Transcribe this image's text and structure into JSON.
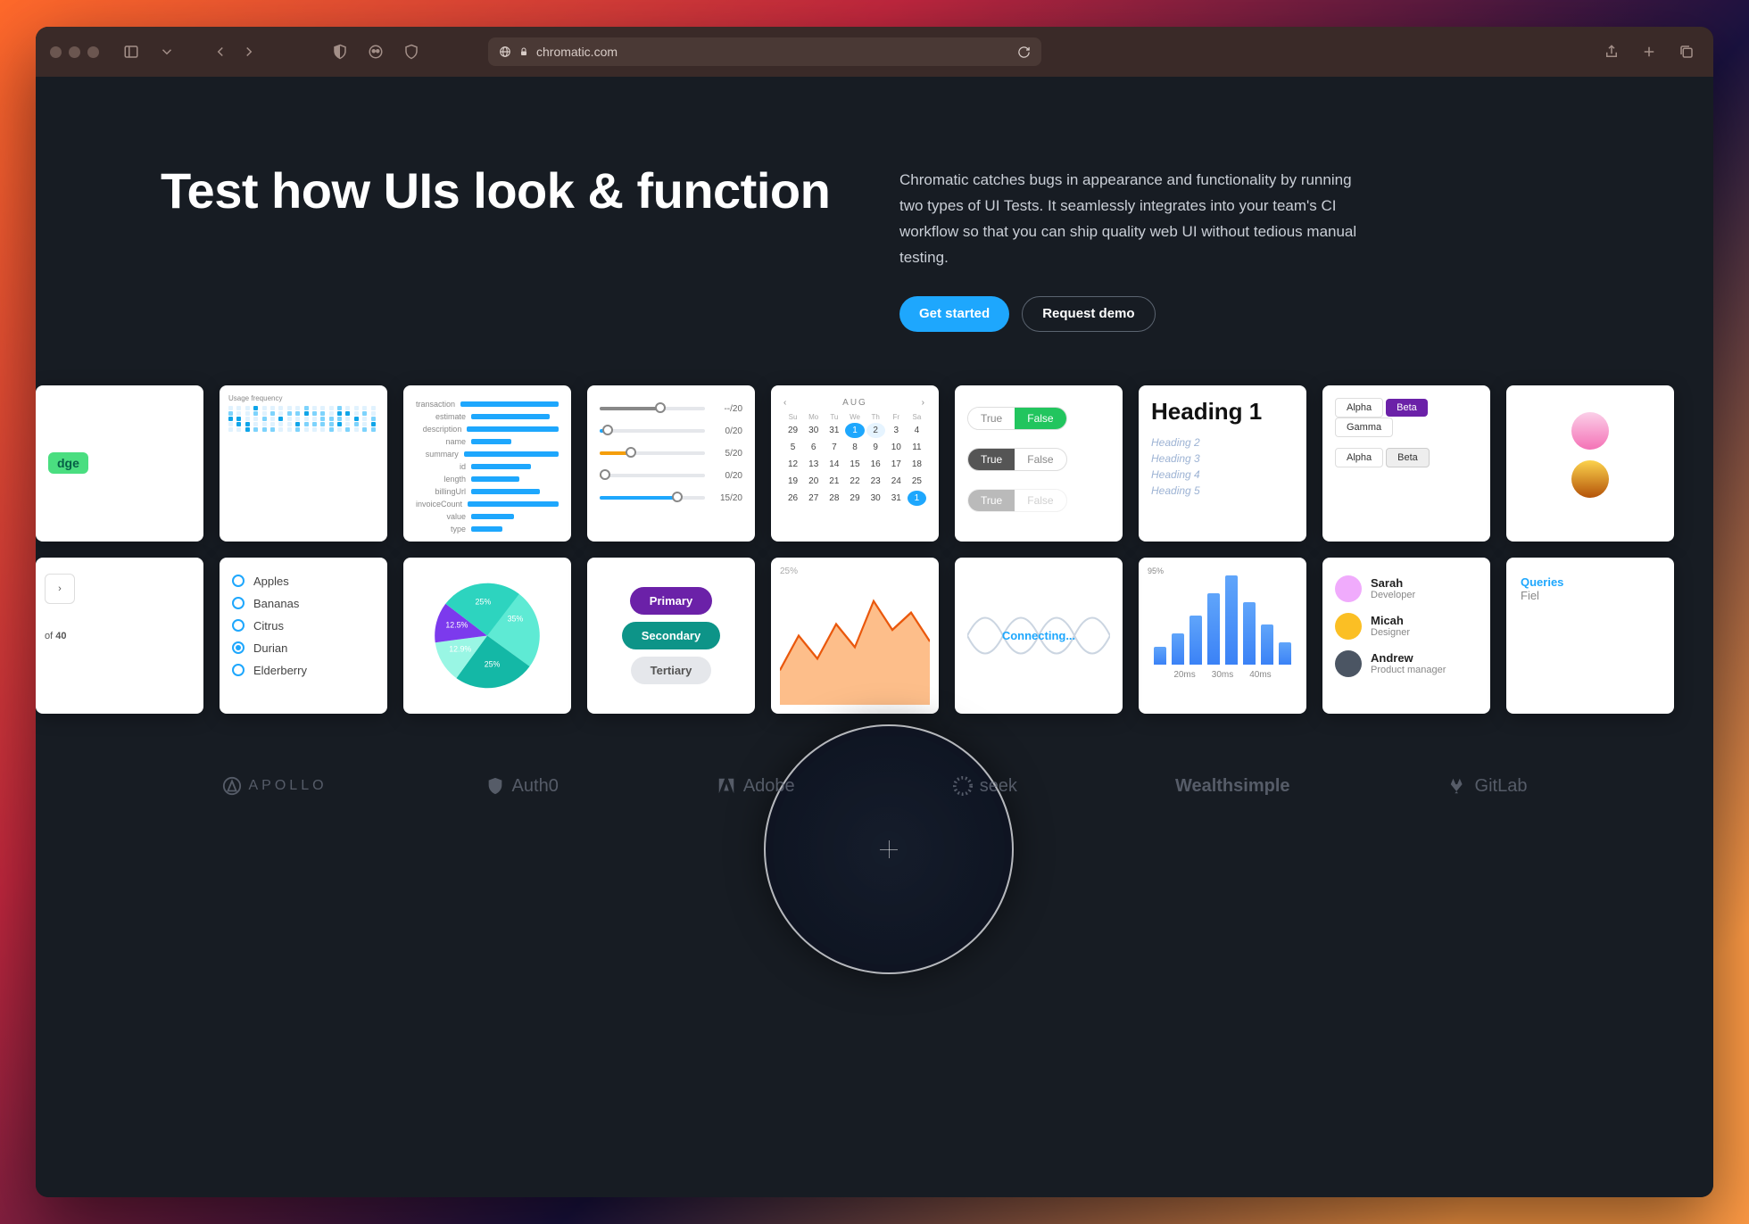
{
  "browser": {
    "url": "chromatic.com"
  },
  "hero": {
    "title": "Test how UIs look & function",
    "body": "Chromatic catches bugs in appearance and functionality by running two types of UI Tests. It seamlessly integrates into your team's CI workflow so that you can ship quality web UI without tedious manual testing.",
    "cta_primary": "Get started",
    "cta_secondary": "Request demo"
  },
  "cards": {
    "badge": "dge",
    "heatmap_title": "Usage frequency",
    "bar_labels": [
      "transaction",
      "estimate",
      "description",
      "name",
      "summary",
      "id",
      "length",
      "billingUrl",
      "invoiceCount",
      "value",
      "type"
    ],
    "bar_values": [
      90,
      55,
      70,
      28,
      78,
      42,
      34,
      48,
      88,
      30,
      22
    ],
    "sliders": [
      {
        "val": "--/20",
        "pct": 58,
        "fill": "#888"
      },
      {
        "val": "0/20",
        "pct": 8,
        "fill": "#1ea7fd"
      },
      {
        "val": "5/20",
        "pct": 30,
        "fill": "#f59e0b"
      },
      {
        "val": "0/20",
        "pct": 5,
        "fill": "#f59e0b"
      },
      {
        "val": "15/20",
        "pct": 74,
        "fill": "#1ea7fd"
      }
    ],
    "calendar": {
      "month": "AUG",
      "dow": [
        "Su",
        "Mo",
        "Tu",
        "We",
        "Th",
        "Fr",
        "Sa"
      ],
      "days": [
        29,
        30,
        31,
        1,
        2,
        3,
        4,
        5,
        6,
        7,
        8,
        9,
        10,
        11,
        12,
        13,
        14,
        15,
        16,
        17,
        18,
        19,
        20,
        21,
        22,
        23,
        24,
        25,
        26,
        27,
        28,
        29,
        30,
        31,
        1
      ],
      "selected": 1,
      "highlight": 2
    },
    "toggles": [
      {
        "on": "True",
        "off": "False",
        "style": "green"
      },
      {
        "on": "True",
        "off": "False",
        "style": "plain"
      },
      {
        "on": "True",
        "off": "False",
        "style": "faded"
      }
    ],
    "heading": {
      "h1": "Heading 1",
      "lines": [
        "Heading 2",
        "Heading 3",
        "Heading 4",
        "Heading 5"
      ]
    },
    "pills": {
      "row1": [
        "Alpha",
        "Beta",
        "Gamma"
      ],
      "row2": [
        "Alpha",
        "Beta"
      ]
    },
    "list": [
      "Apples",
      "Bananas",
      "Citrus",
      "Durian",
      "Elderberry"
    ],
    "list_selected": 3,
    "pager": {
      "of": "of",
      "total": "40"
    },
    "pie": [
      {
        "label": "35%",
        "val": 35,
        "color": "#5eead4"
      },
      {
        "label": "25%",
        "val": 25,
        "color": "#14b8a6"
      },
      {
        "label": "12.9%",
        "val": 12.9,
        "color": "#99f6e4"
      },
      {
        "label": "12.5%",
        "val": 12.5,
        "color": "#7c3aed"
      },
      {
        "label": "25%",
        "val": 25,
        "color": "#2dd4bf"
      }
    ],
    "buttons": [
      "Primary",
      "Secondary",
      "Tertiary"
    ],
    "area_pct": "25%",
    "connecting": "Connecting...",
    "hist": {
      "vals": [
        20,
        35,
        55,
        80,
        100,
        70,
        45,
        25
      ],
      "pct": "95%",
      "ticks": [
        "20ms",
        "30ms",
        "40ms"
      ]
    },
    "people": [
      {
        "name": "Sarah",
        "role": "Developer",
        "color": "#f0abfc"
      },
      {
        "name": "Micah",
        "role": "Designer",
        "color": "#fbbf24"
      },
      {
        "name": "Andrew",
        "role": "Product manager",
        "color": "#4b5563"
      }
    ],
    "tabs": [
      "Queries",
      "Fiel"
    ]
  },
  "logos": [
    "APOLLO",
    "Auth0",
    "Adobe",
    "seek",
    "Wealthsimple",
    "GitLab"
  ]
}
